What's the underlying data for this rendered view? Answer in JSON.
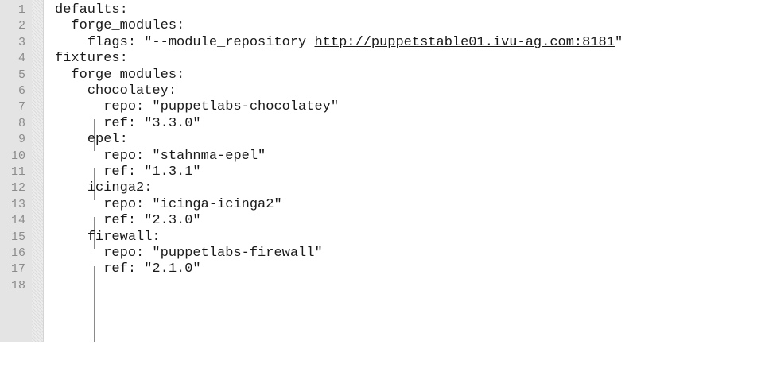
{
  "editor": {
    "line_numbers": [
      "1",
      "2",
      "3",
      "4",
      "5",
      "6",
      "7",
      "8",
      "9",
      "10",
      "11",
      "12",
      "13",
      "14",
      "15",
      "16",
      "17",
      "18"
    ],
    "lines": [
      {
        "indent": "",
        "text": "defaults:"
      },
      {
        "indent": "  ",
        "text": "forge_modules:"
      },
      {
        "indent": "    ",
        "text": "flags: \"--module_repository ",
        "link": "http://puppetstable01.ivu-ag.com:8181",
        "after": "\""
      },
      {
        "indent": "",
        "text": "fixtures:"
      },
      {
        "indent": "  ",
        "text": "forge_modules:"
      },
      {
        "indent": "    ",
        "text": "chocolatey:"
      },
      {
        "indent": "      ",
        "text": "repo: \"puppetlabs-chocolatey\""
      },
      {
        "indent": "      ",
        "text": "ref: \"3.3.0\""
      },
      {
        "indent": "    ",
        "text": "epel:"
      },
      {
        "indent": "      ",
        "text": "repo: \"stahnma-epel\""
      },
      {
        "indent": "      ",
        "text": "ref: \"1.3.1\""
      },
      {
        "indent": "    ",
        "text": "icinga2:"
      },
      {
        "indent": "      ",
        "text": "repo: \"icinga-icinga2\""
      },
      {
        "indent": "      ",
        "text": "ref: \"2.3.0\""
      },
      {
        "indent": "    ",
        "text": "firewall:"
      },
      {
        "indent": "      ",
        "text": "repo: \"puppetlabs-firewall\""
      },
      {
        "indent": "      ",
        "text": "ref: \"2.1.0\""
      },
      {
        "indent": "",
        "text": ""
      }
    ]
  }
}
